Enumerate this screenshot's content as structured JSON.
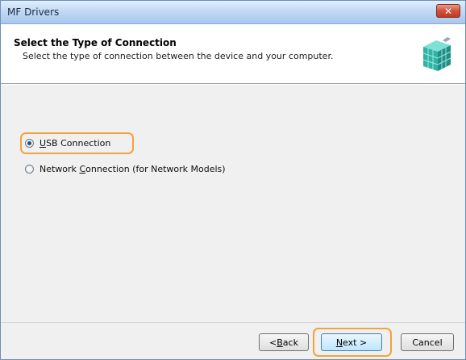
{
  "window": {
    "title": "MF Drivers",
    "close_label": "✕"
  },
  "header": {
    "title": "Select the Type of Connection",
    "subtitle": "Select the type of connection between the device and your computer."
  },
  "options": [
    {
      "accel": "U",
      "rest": "SB Connection",
      "checked": true
    },
    {
      "pre": "Network ",
      "accel": "C",
      "rest": "onnection (for Network Models)",
      "checked": false
    }
  ],
  "buttons": {
    "back": {
      "pre": "< ",
      "accel": "B",
      "rest": "ack"
    },
    "next": {
      "accel": "N",
      "rest": "ext >"
    },
    "cancel": "Cancel"
  },
  "colors": {
    "highlight": "#f2a33a",
    "header_bg": "#ffffff",
    "body_bg": "#f0f0f0"
  }
}
